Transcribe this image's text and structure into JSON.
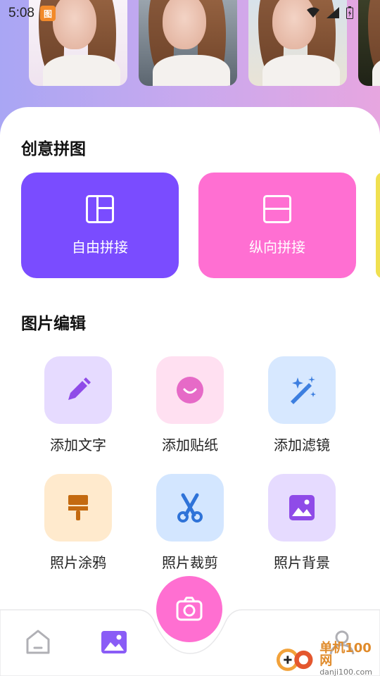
{
  "status_bar": {
    "time": "5:08",
    "app_icon_text": "图"
  },
  "hero": {
    "thumbnails": [
      {
        "name": "style-plain",
        "bg": "#f6eef6"
      },
      {
        "name": "style-city",
        "bg": "#7d8792"
      },
      {
        "name": "style-beach",
        "bg": "#cfd9e3"
      },
      {
        "name": "style-dark",
        "bg": "#2f3320"
      }
    ]
  },
  "creative_collage": {
    "title": "创意拼图",
    "cards": [
      {
        "label": "自由拼接",
        "color": "#7a4cff",
        "icon": "free-layout-icon"
      },
      {
        "label": "纵向拼接",
        "color": "#ff6fd2",
        "icon": "vertical-layout-icon"
      }
    ]
  },
  "photo_edit": {
    "title": "图片编辑",
    "tools": [
      {
        "label": "添加文字",
        "bg": "#e6dbff",
        "icon": "pencil-icon"
      },
      {
        "label": "添加贴纸",
        "bg": "#ffe0f1",
        "icon": "sticker-smile-icon"
      },
      {
        "label": "添加滤镜",
        "bg": "#d7e8ff",
        "icon": "magic-wand-icon"
      },
      {
        "label": "照片涂鸦",
        "bg": "#ffeacd",
        "icon": "paint-brush-icon"
      },
      {
        "label": "照片裁剪",
        "bg": "#d3e6ff",
        "icon": "scissors-icon"
      },
      {
        "label": "照片背景",
        "bg": "#e6dbff",
        "icon": "image-background-icon"
      }
    ]
  },
  "bottom_nav": {
    "items": [
      {
        "name": "home",
        "icon": "home-icon"
      },
      {
        "name": "gallery",
        "icon": "gallery-icon"
      },
      {
        "name": "camera",
        "icon": "camera-icon"
      },
      {
        "name": "profile",
        "icon": "user-icon"
      }
    ]
  },
  "watermark": {
    "text": "单机100网",
    "sub": "danji100.com"
  },
  "colors": {
    "accent_purple": "#7a4cff",
    "accent_pink": "#ff6fd2",
    "nav_active": "#8a5cf6"
  }
}
